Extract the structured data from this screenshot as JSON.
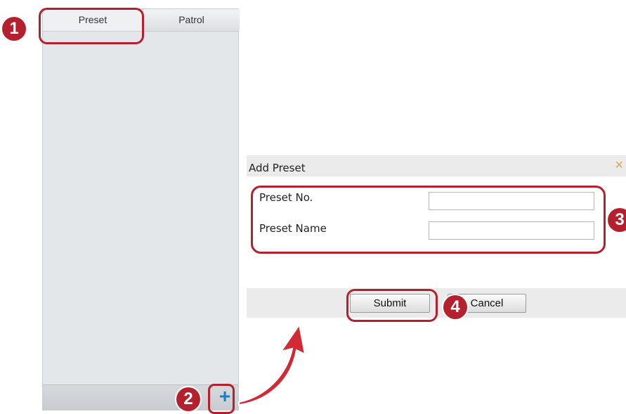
{
  "panel": {
    "tabs": [
      {
        "label": "Preset"
      },
      {
        "label": "Patrol"
      }
    ],
    "add_icon": "+"
  },
  "dialog": {
    "title": "Add Preset",
    "close_icon": "×",
    "fields": [
      {
        "label": "Preset No.",
        "value": ""
      },
      {
        "label": "Preset Name",
        "value": ""
      }
    ],
    "submit_label": "Submit",
    "cancel_label": "Cancel"
  },
  "callouts": [
    "1",
    "2",
    "3",
    "4"
  ],
  "colors": {
    "accent": "#b5202e",
    "add_icon": "#1a7fc4",
    "close_icon": "#d9a550"
  },
  "icons": [
    "plus-icon",
    "close-icon",
    "curved-arrow-icon"
  ]
}
